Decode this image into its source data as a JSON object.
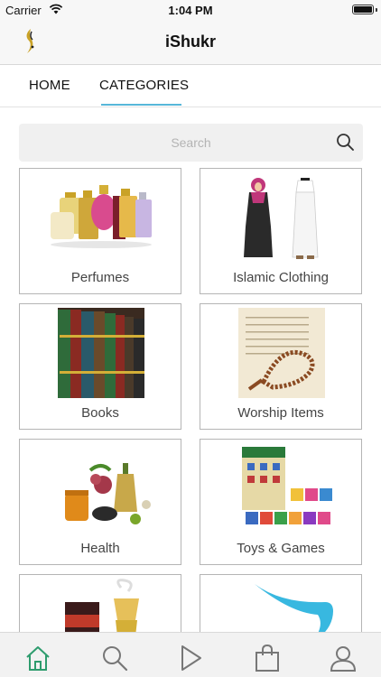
{
  "status_bar": {
    "carrier": "Carrier",
    "time": "1:04 PM"
  },
  "header": {
    "title": "iShukr"
  },
  "tabs": [
    {
      "label": "HOME",
      "active": false
    },
    {
      "label": "CATEGORIES",
      "active": true
    }
  ],
  "search": {
    "placeholder": "Search",
    "value": ""
  },
  "categories": [
    {
      "label": "Perfumes",
      "image": "perfume-bottles"
    },
    {
      "label": "Islamic Clothing",
      "image": "man-woman-clothing"
    },
    {
      "label": "Books",
      "image": "bookshelf"
    },
    {
      "label": "Worship Items",
      "image": "prayer-beads-quran"
    },
    {
      "label": "Health",
      "image": "honey-herbs"
    },
    {
      "label": "Toys & Games",
      "image": "letter-blocks"
    },
    {
      "label": "",
      "image": "incense-burner"
    },
    {
      "label": "",
      "image": "blue-swoosh"
    }
  ],
  "bottom_nav": [
    {
      "icon": "home-icon",
      "active": true
    },
    {
      "icon": "search-icon",
      "active": false
    },
    {
      "icon": "play-icon",
      "active": false
    },
    {
      "icon": "shopping-bag-icon",
      "active": false
    },
    {
      "icon": "user-icon",
      "active": false
    }
  ],
  "colors": {
    "accent": "#57b7d9",
    "nav_active": "#2e9c6e",
    "nav_inactive": "#777777"
  }
}
